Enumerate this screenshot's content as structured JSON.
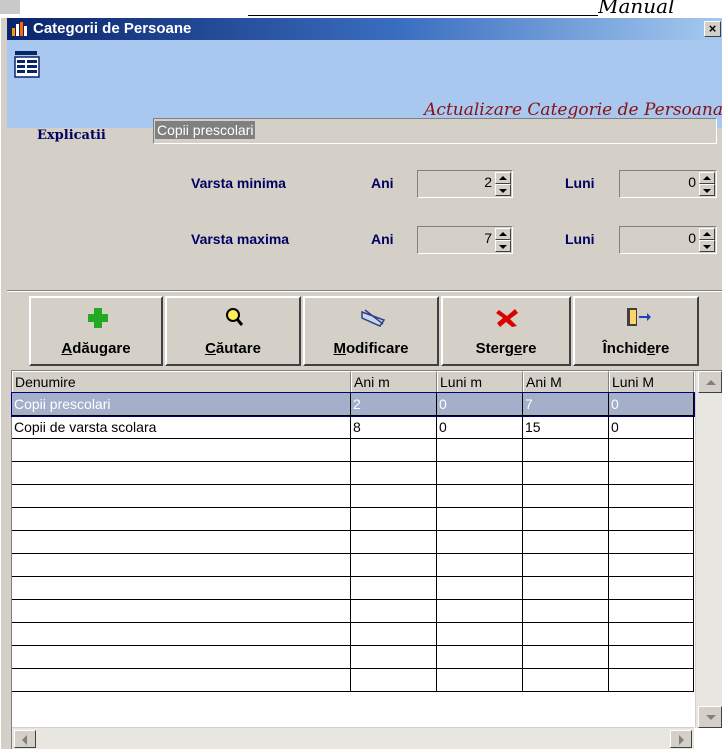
{
  "document": {
    "partial_text": "Manual"
  },
  "window": {
    "title": "Categorii de Persoane",
    "close_label": "×"
  },
  "header": {
    "form_icon": "data-form-icon",
    "title": "Actualizare Categorie de Persoana"
  },
  "form": {
    "explicatii_label": "Explicatii",
    "explicatii_value": "Copii prescolari",
    "varsta_minima_label": "Varsta minima",
    "varsta_maxima_label": "Varsta maxima",
    "ani_label": "Ani",
    "luni_label": "Luni",
    "min_ani": "2",
    "min_luni": "0",
    "max_ani": "7",
    "max_luni": "0"
  },
  "toolbar": {
    "adaugare": "Adăugare",
    "cautare": "Căutare",
    "modificare": "Modificare",
    "stergere": "Stergere",
    "inchidere": "Închidere",
    "icons": [
      "plus-icon",
      "search-icon",
      "edit-icon",
      "delete-icon",
      "exit-door-icon"
    ],
    "colors": {
      "plus": "#22aa22",
      "delete": "#dd0000",
      "title_text": "#8b1010",
      "label_text": "#000060"
    }
  },
  "grid": {
    "columns": [
      "Denumire",
      "Ani m",
      "Luni m",
      "Ani M",
      "Luni M"
    ],
    "rows": [
      [
        "Copii prescolari",
        "2",
        "0",
        "7",
        "0"
      ],
      [
        "Copii de varsta scolara",
        "8",
        "0",
        "15",
        "0"
      ]
    ],
    "selected_row": 0,
    "empty_rows": 11
  }
}
